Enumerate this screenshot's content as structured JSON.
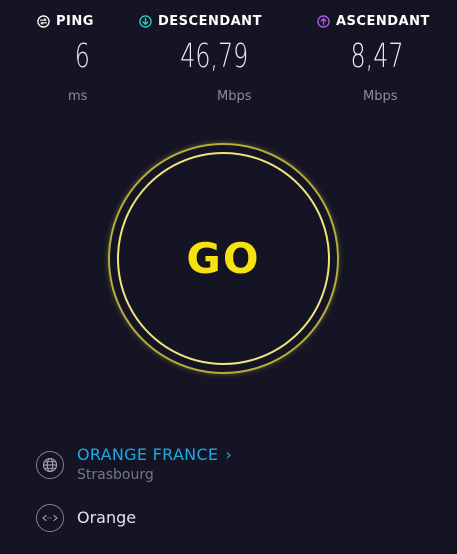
{
  "metrics": {
    "ping": {
      "label": "PING",
      "value": "6",
      "unit": "ms",
      "icon": "ping-icon",
      "icon_color": "#ffffff"
    },
    "download": {
      "label": "DESCENDANT",
      "value": "46,79",
      "unit": "Mbps",
      "icon": "download-arrow-icon",
      "icon_color": "#2fd1c4"
    },
    "upload": {
      "label": "ASCENDANT",
      "value": "8,47",
      "unit": "Mbps",
      "icon": "upload-arrow-icon",
      "icon_color": "#b45cf0"
    }
  },
  "go_button": {
    "label": "GO",
    "color": "#f5e20e",
    "ring_color": "#efe57a"
  },
  "server": {
    "name": "ORANGE FRANCE",
    "location": "Strasbourg",
    "icon": "globe-icon",
    "name_color": "#1ea8e6"
  },
  "isp": {
    "name": "Orange",
    "icon": "connection-icon"
  },
  "colors": {
    "background": "#141425"
  }
}
